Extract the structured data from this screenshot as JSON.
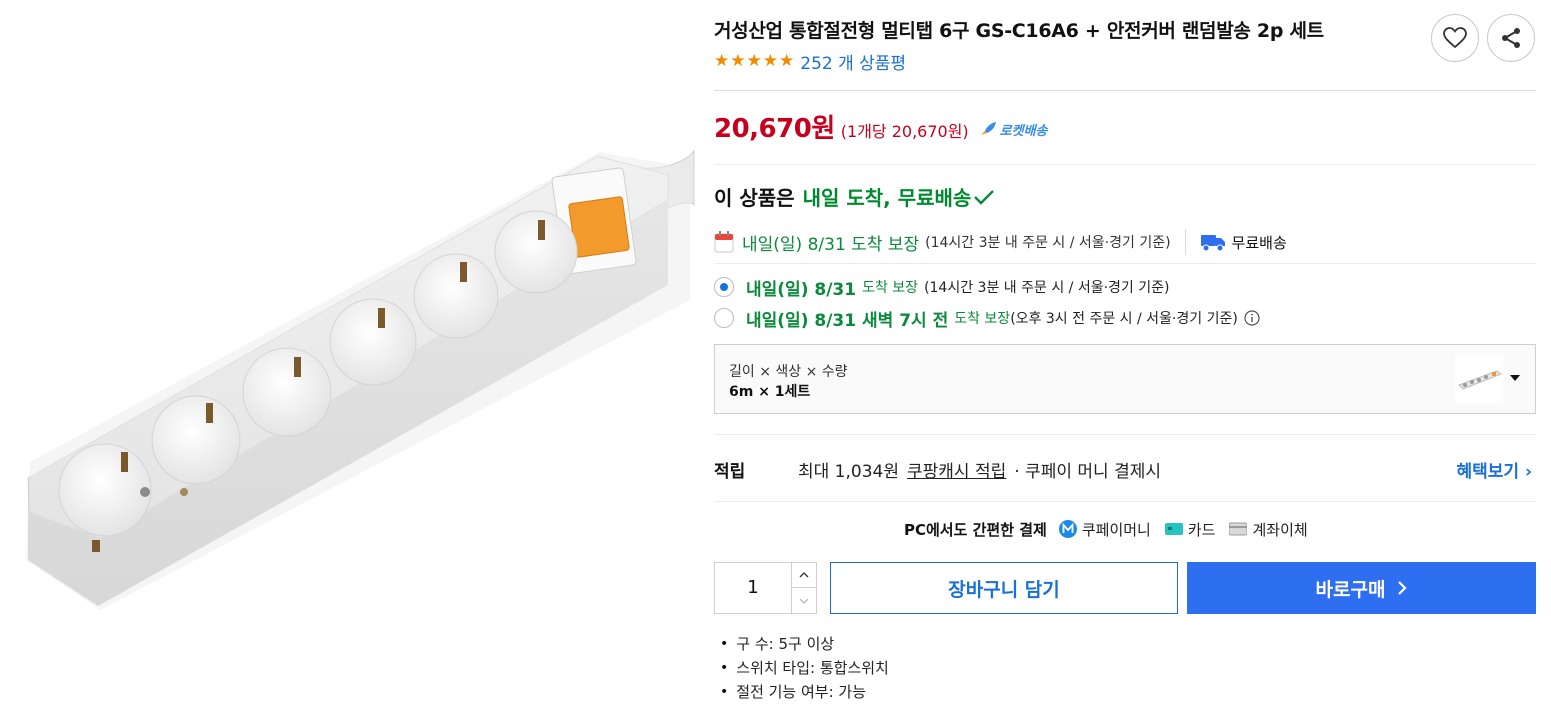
{
  "product": {
    "title": "거성산업 통합절전형 멀티탭 6구 GS-C16A6 + 안전커버 랜덤발송 2p 세트",
    "review_count_text": "252 개 상품평",
    "rating_stars": 5
  },
  "price": {
    "amount": "20,670원",
    "unit_price": "(1개당 20,670원)",
    "badge": "로켓배송"
  },
  "delivery": {
    "headline_prefix": "이 상품은",
    "headline_green": "내일 도착, 무료배송",
    "guarantee_text": "내일(일) 8/31 도착 보장",
    "guarantee_note": "(14시간 3분 내 주문 시 / 서울·경기 기준)",
    "free_shipping": "무료배송",
    "options": [
      {
        "main": "내일(일) 8/31",
        "sub": "도착 보장",
        "note": "(14시간 3분 내 주문 시 / 서울·경기 기준)",
        "selected": true
      },
      {
        "main": "내일(일) 8/31 새벽 7시 전",
        "sub": "도착 보장",
        "note": "(오후 3시 전 주문 시 / 서울·경기 기준)",
        "selected": false
      }
    ]
  },
  "option_select": {
    "label": "길이 × 색상 × 수량",
    "value": "6m × 1세트"
  },
  "reward": {
    "label": "적립",
    "text": "최대 1,034원",
    "link": "쿠팡캐시 적립",
    "tail": "· 쿠페이 머니 결제시",
    "benefit_link": "혜택보기"
  },
  "payment": {
    "title": "PC에서도 간편한 결제",
    "methods": [
      "쿠페이머니",
      "카드",
      "계좌이체"
    ]
  },
  "purchase": {
    "quantity": "1",
    "cart_label": "장바구니 담기",
    "buy_label": "바로구매"
  },
  "specs": [
    "구 수: 5구 이상",
    "스위치 타입: 통합스위치",
    "절전 기능 여부: 가능"
  ],
  "colors": {
    "price_red": "#c8001e",
    "delivery_green": "#0a8a3a",
    "accent_blue": "#2e6ef0",
    "star_orange": "#f08c00"
  }
}
